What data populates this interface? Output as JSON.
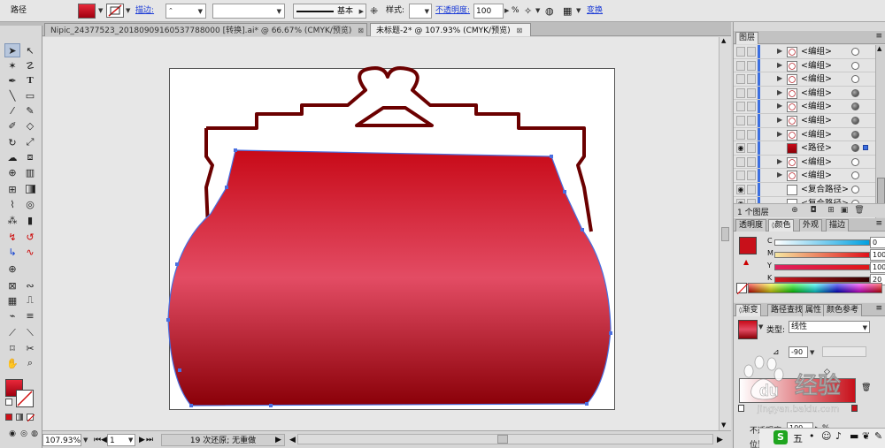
{
  "control_bar": {
    "selection_type": "路径",
    "stroke_label": "描边:",
    "stroke_profile": "基本",
    "style_label": "样式:",
    "opacity_label": "不透明度:",
    "opacity_value": "100",
    "opacity_unit": "%",
    "transform_label": "变换"
  },
  "doc_tabs": [
    {
      "title": "Nipic_24377523_20180909160537788000  [转换].ai* @ 66.67% (CMYK/预览)",
      "active": false
    },
    {
      "title": "未标题-2* @ 107.93% (CMYK/预览)",
      "active": true
    }
  ],
  "canvas": {
    "shape_gradient_top": "#c80a18",
    "shape_gradient_mid": "#e34c64",
    "shape_gradient_bottom": "#8a0008",
    "outline_color": "#6b0000",
    "anchor_color": "#4a6fe0"
  },
  "status_bar": {
    "zoom": "107.93%",
    "page": "1",
    "history": "19 次还原; 无重做"
  },
  "layers_panel": {
    "title": "图层",
    "rows": [
      {
        "name": "<编组>",
        "visible": false,
        "expand": true,
        "target": "hollow"
      },
      {
        "name": "<编组>",
        "visible": false,
        "expand": true,
        "target": "hollow"
      },
      {
        "name": "<编组>",
        "visible": false,
        "expand": true,
        "target": "hollow"
      },
      {
        "name": "<编组>",
        "visible": false,
        "expand": true,
        "target": "filled"
      },
      {
        "name": "<编组>",
        "visible": false,
        "expand": true,
        "target": "filled"
      },
      {
        "name": "<编组>",
        "visible": false,
        "expand": true,
        "target": "filled"
      },
      {
        "name": "<编组>",
        "visible": false,
        "expand": true,
        "target": "filled"
      },
      {
        "name": "<路径>",
        "visible": true,
        "expand": false,
        "target": "filled",
        "selected": true
      },
      {
        "name": "<编组>",
        "visible": false,
        "expand": true,
        "target": "hollow"
      },
      {
        "name": "<编组>",
        "visible": false,
        "expand": true,
        "target": "hollow"
      },
      {
        "name": "<复合路径>",
        "visible": true,
        "expand": false,
        "target": "hollow"
      },
      {
        "name": "<复合路径>",
        "visible": true,
        "expand": false,
        "target": "hollow"
      }
    ],
    "footer": "1 个图层"
  },
  "color_panel": {
    "tabs": [
      "透明度",
      "颜色",
      "外观",
      "描边"
    ],
    "active_tab": "颜色",
    "fill_color": "#c8101a",
    "channels": [
      {
        "label": "C",
        "value": "0",
        "gradient": [
          "#ffffff",
          "#00a0e0"
        ]
      },
      {
        "label": "M",
        "value": "100",
        "gradient": [
          "#f6e6a0",
          "#e0101a"
        ]
      },
      {
        "label": "Y",
        "value": "100",
        "gradient": [
          "#e02060",
          "#e01818"
        ]
      },
      {
        "label": "K",
        "value": "20",
        "gradient": [
          "#d01820",
          "#300000"
        ]
      }
    ]
  },
  "gradient_panel": {
    "tabs": [
      "渐变",
      "路径查找",
      "属性",
      "颜色参考"
    ],
    "active_tab": "渐变",
    "type_label": "类型:",
    "type_value": "线性",
    "angle": "-90",
    "opacity_label": "不透明度:",
    "opacity_value": "100",
    "location_label": "位置:"
  },
  "taskbar": {
    "ime": "五"
  },
  "watermark": {
    "brand": "经验",
    "url": "jingyan.baidu.com"
  }
}
